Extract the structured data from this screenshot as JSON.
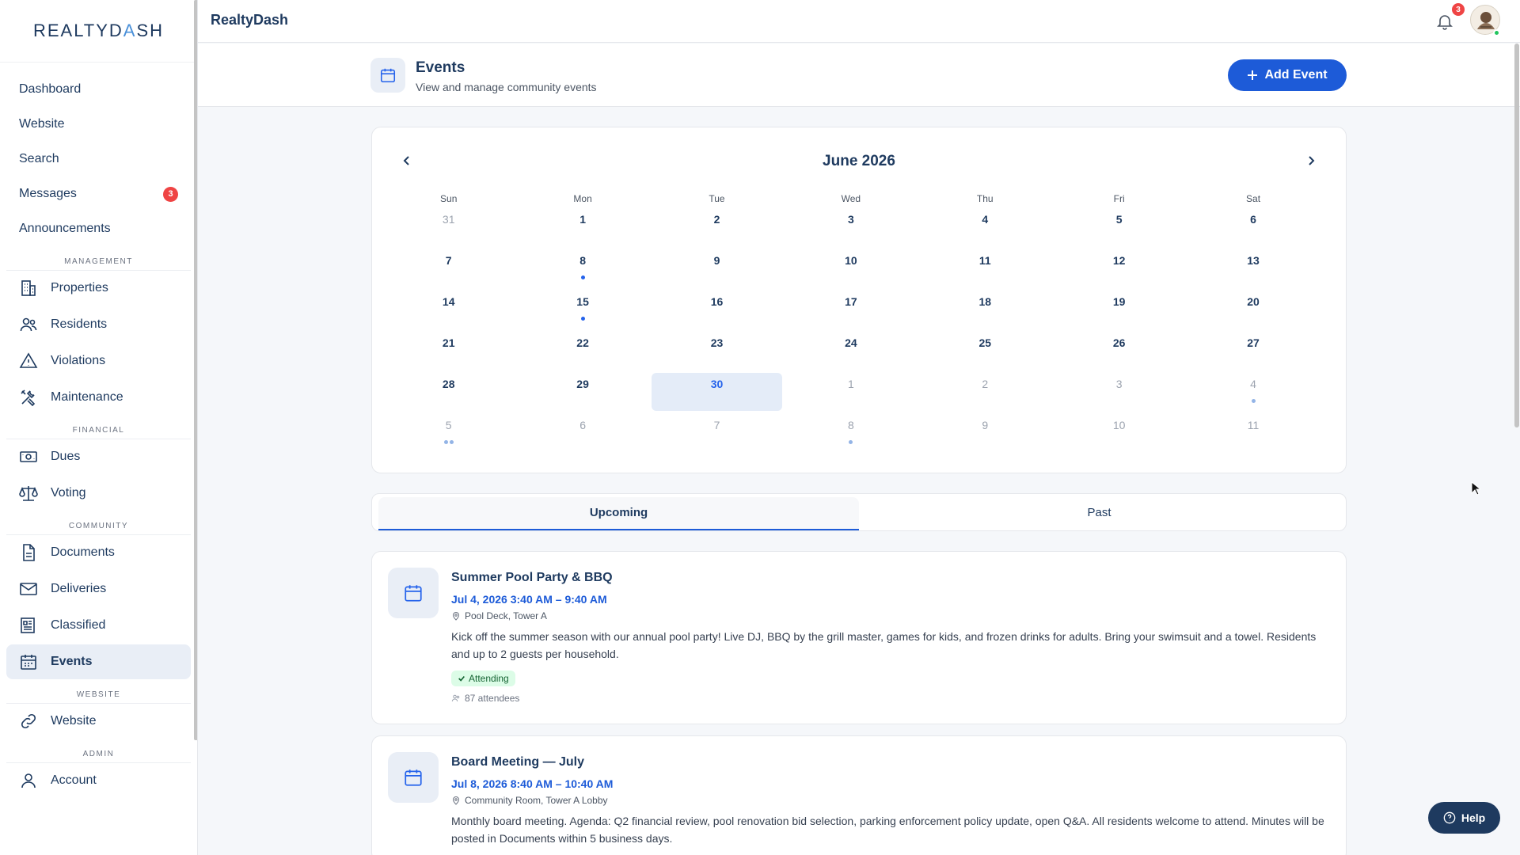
{
  "brand": {
    "logo_prefix": "REALTYD",
    "logo_accent": "A",
    "logo_suffix": "SH",
    "app_title": "RealtyDash"
  },
  "topbar": {
    "notification_count": "3"
  },
  "sidebar": {
    "top_items": [
      {
        "label": "Dashboard"
      },
      {
        "label": "Website"
      },
      {
        "label": "Search"
      },
      {
        "label": "Messages",
        "badge": "3"
      },
      {
        "label": "Announcements"
      }
    ],
    "sections": {
      "management": "MANAGEMENT",
      "financial": "FINANCIAL",
      "community": "COMMUNITY",
      "website": "WEBSITE",
      "admin": "ADMIN"
    },
    "management_items": [
      {
        "label": "Properties",
        "icon": "building-icon"
      },
      {
        "label": "Residents",
        "icon": "users-icon"
      },
      {
        "label": "Violations",
        "icon": "warning-icon"
      },
      {
        "label": "Maintenance",
        "icon": "tools-icon"
      }
    ],
    "financial_items": [
      {
        "label": "Dues",
        "icon": "money-icon"
      },
      {
        "label": "Voting",
        "icon": "scale-icon"
      }
    ],
    "community_items": [
      {
        "label": "Documents",
        "icon": "document-icon"
      },
      {
        "label": "Deliveries",
        "icon": "mail-icon"
      },
      {
        "label": "Classified",
        "icon": "newspaper-icon"
      },
      {
        "label": "Events",
        "icon": "calendar-icon",
        "active": true
      }
    ],
    "website_items": [
      {
        "label": "Website",
        "icon": "link-icon"
      }
    ],
    "admin_items": [
      {
        "label": "Account",
        "icon": "user-icon"
      }
    ]
  },
  "page": {
    "title": "Events",
    "subtitle": "View and manage community events",
    "add_button": "Add Event"
  },
  "calendar": {
    "month_label": "June 2026",
    "weekdays": [
      "Sun",
      "Mon",
      "Tue",
      "Wed",
      "Thu",
      "Fri",
      "Sat"
    ],
    "days": [
      {
        "n": "31",
        "muted": true,
        "dots": 0
      },
      {
        "n": "1",
        "dots": 0
      },
      {
        "n": "2",
        "dots": 0
      },
      {
        "n": "3",
        "dots": 0
      },
      {
        "n": "4",
        "dots": 0
      },
      {
        "n": "5",
        "dots": 0
      },
      {
        "n": "6",
        "dots": 0
      },
      {
        "n": "7",
        "dots": 0
      },
      {
        "n": "8",
        "dots": 1
      },
      {
        "n": "9",
        "dots": 0
      },
      {
        "n": "10",
        "dots": 0
      },
      {
        "n": "11",
        "dots": 0
      },
      {
        "n": "12",
        "dots": 0
      },
      {
        "n": "13",
        "dots": 0
      },
      {
        "n": "14",
        "dots": 0
      },
      {
        "n": "15",
        "dots": 1
      },
      {
        "n": "16",
        "dots": 0
      },
      {
        "n": "17",
        "dots": 0
      },
      {
        "n": "18",
        "dots": 0
      },
      {
        "n": "19",
        "dots": 0
      },
      {
        "n": "20",
        "dots": 0
      },
      {
        "n": "21",
        "dots": 0
      },
      {
        "n": "22",
        "dots": 0
      },
      {
        "n": "23",
        "dots": 0
      },
      {
        "n": "24",
        "dots": 0
      },
      {
        "n": "25",
        "dots": 0
      },
      {
        "n": "26",
        "dots": 0
      },
      {
        "n": "27",
        "dots": 0
      },
      {
        "n": "28",
        "dots": 0
      },
      {
        "n": "29",
        "dots": 0
      },
      {
        "n": "30",
        "today": true,
        "dots": 0
      },
      {
        "n": "1",
        "muted": true,
        "dots": 0
      },
      {
        "n": "2",
        "muted": true,
        "dots": 0
      },
      {
        "n": "3",
        "muted": true,
        "dots": 0
      },
      {
        "n": "4",
        "muted": true,
        "dots": 1
      },
      {
        "n": "5",
        "muted": true,
        "dots": 2
      },
      {
        "n": "6",
        "muted": true,
        "dots": 0
      },
      {
        "n": "7",
        "muted": true,
        "dots": 0
      },
      {
        "n": "8",
        "muted": true,
        "dots": 1
      },
      {
        "n": "9",
        "muted": true,
        "dots": 0
      },
      {
        "n": "10",
        "muted": true,
        "dots": 0
      },
      {
        "n": "11",
        "muted": true,
        "dots": 0
      }
    ]
  },
  "tabs": {
    "upcoming": "Upcoming",
    "past": "Past"
  },
  "events": [
    {
      "title": "Summer Pool Party & BBQ",
      "time": "Jul 4, 2026 3:40 AM – 9:40 AM",
      "location": "Pool Deck, Tower A",
      "description": "Kick off the summer season with our annual pool party! Live DJ, BBQ by the grill master, games for kids, and frozen drinks for adults. Bring your swimsuit and a towel. Residents and up to 2 guests per household.",
      "status": "Attending",
      "attendees": "87 attendees"
    },
    {
      "title": "Board Meeting — July",
      "time": "Jul 8, 2026 8:40 AM – 10:40 AM",
      "location": "Community Room, Tower A Lobby",
      "description": "Monthly board meeting. Agenda: Q2 financial review, pool renovation bid selection, parking enforcement policy update, open Q&A. All residents welcome to attend. Minutes will be posted in Documents within 5 business days."
    }
  ],
  "help": {
    "label": "Help"
  },
  "colors": {
    "primary": "#1d5bd8",
    "navy": "#1e3a5f",
    "badge": "#ef4444",
    "attending_bg": "#dcfce7"
  }
}
